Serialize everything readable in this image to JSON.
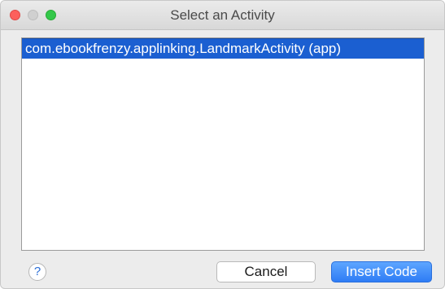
{
  "window": {
    "title": "Select an Activity"
  },
  "list": {
    "items": [
      {
        "label": "com.ebookfrenzy.applinking.LandmarkActivity (app)",
        "selected": true
      }
    ]
  },
  "footer": {
    "help_label": "?",
    "cancel_label": "Cancel",
    "insert_label": "Insert Code"
  },
  "colors": {
    "selection": "#1b5fd1",
    "primary_button": "#2e7cf5",
    "close_light": "#fc605c",
    "minimize_light": "#d0d0d0",
    "zoom_light": "#34c84a"
  },
  "icons": {
    "close": "close-window-icon",
    "minimize": "minimize-window-icon",
    "zoom": "zoom-window-icon",
    "help": "help-icon"
  }
}
